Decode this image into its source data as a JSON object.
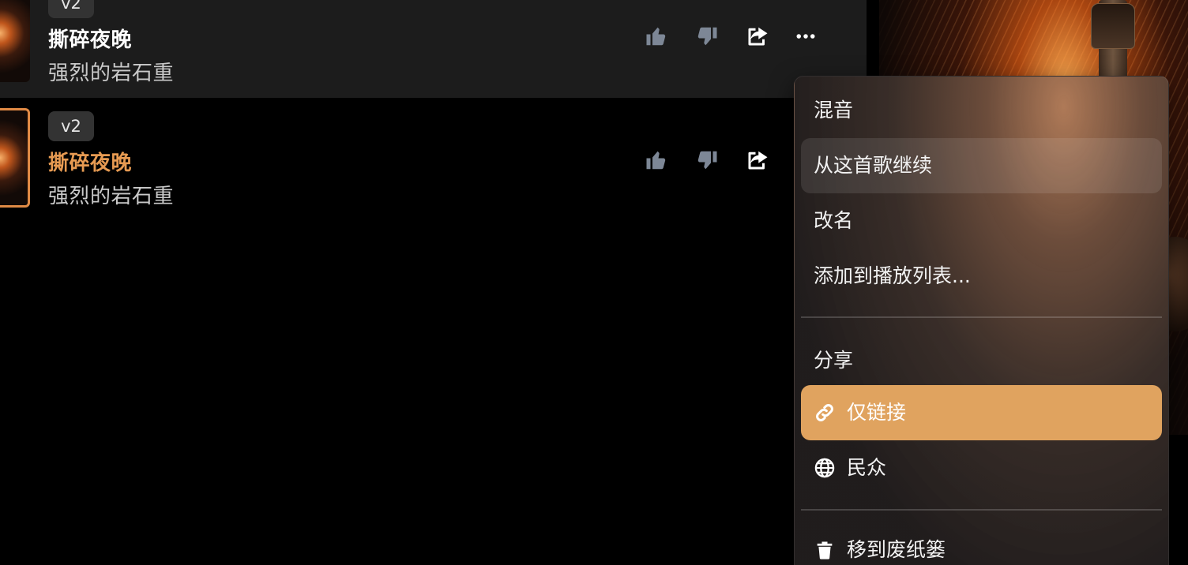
{
  "tracks": [
    {
      "version": "v2",
      "title": "撕碎夜晚",
      "subtitle": "强烈的岩石重",
      "active": false
    },
    {
      "version": "v2",
      "title": "撕碎夜晚",
      "subtitle": "强烈的岩石重",
      "active": true
    }
  ],
  "icons": {
    "like": "thumbs-up-icon",
    "dislike": "thumbs-down-icon",
    "share": "share-icon",
    "more": "more-options-icon",
    "link": "link-icon",
    "globe": "globe-icon",
    "trash": "trash-icon"
  },
  "colors": {
    "accent": "#e0a35f",
    "active_title": "#e69a52",
    "icon_gray": "#7d8796"
  },
  "context_menu": {
    "remix": "混音",
    "continue_from_song": "从这首歌继续",
    "rename": "改名",
    "add_to_playlist": "添加到播放列表...",
    "share_section": "分享",
    "link_only": "仅链接",
    "public": "民众",
    "move_to_trash": "移到废纸篓"
  }
}
